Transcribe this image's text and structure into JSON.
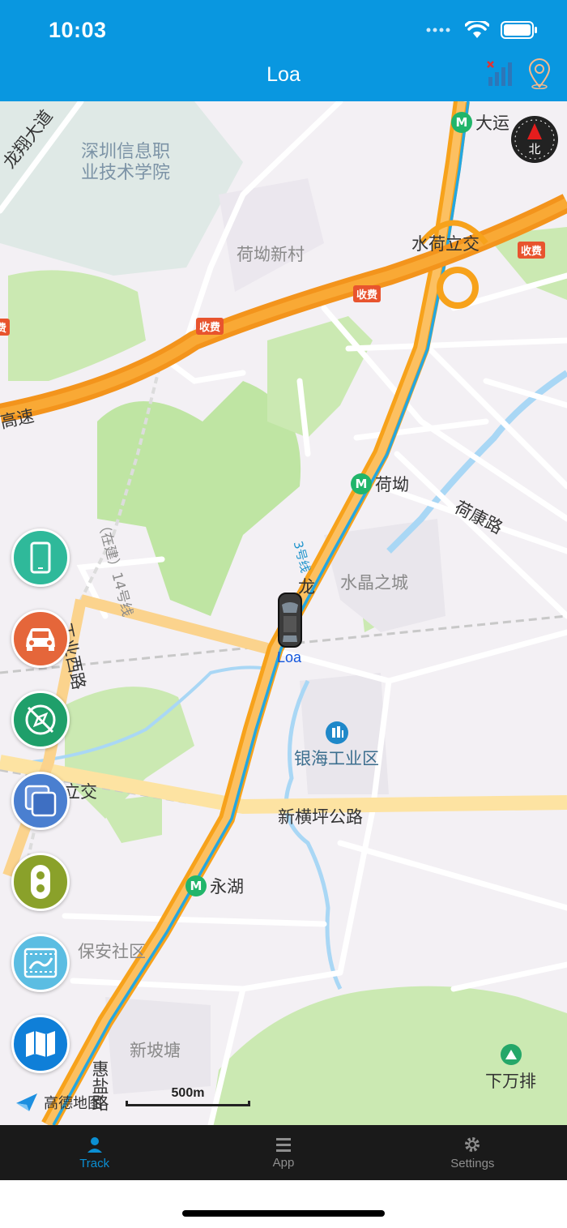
{
  "status_bar": {
    "time": "10:03"
  },
  "nav": {
    "title": "Loa"
  },
  "map": {
    "labels": {
      "school": "深圳信息职\n业技术学院",
      "longxiang": "龙翔大道",
      "hebei_village": "荷坳新村",
      "shuihe": "水荷立交",
      "gaosu": "高速",
      "zaijian": "（在建）14号线",
      "line3": "3号线",
      "hekang": "荷康路",
      "shuijing": "水晶之城",
      "long": "龙",
      "gongye_road": "工业西路",
      "yinhai": "银海工业区",
      "lijiao": "立交",
      "xinhengping": "新横坪公路",
      "baoan": "保安社区",
      "xinpotang": "新坡塘",
      "huiyan": "惠盐路",
      "xiawanpai": "下万排"
    },
    "toll_label": "收费",
    "metro_stations": {
      "dayun": "大运",
      "heao": "荷坳",
      "yonghu": "永湖"
    },
    "compass_label": "北",
    "vehicle_label": "Loa",
    "provider": "高德地图",
    "scale": "500m"
  },
  "side_buttons": [
    {
      "name": "phone",
      "color": "#2fb99a"
    },
    {
      "name": "car",
      "color": "#e5663a"
    },
    {
      "name": "compass-off",
      "color": "#1f9f6a"
    },
    {
      "name": "layers",
      "color": "#4a7fd0"
    },
    {
      "name": "traffic",
      "color": "#8aa12a"
    },
    {
      "name": "playback",
      "color": "#5bbde2"
    },
    {
      "name": "map",
      "color": "#0f7fd8"
    }
  ],
  "tabs": [
    {
      "label": "Track",
      "active": true
    },
    {
      "label": "App",
      "active": false
    },
    {
      "label": "Settings",
      "active": false
    }
  ],
  "colors": {
    "header": "#0997e0",
    "tab_active": "#0b8fd3",
    "highway": "#f7a21b",
    "metro": "#21b56a"
  }
}
